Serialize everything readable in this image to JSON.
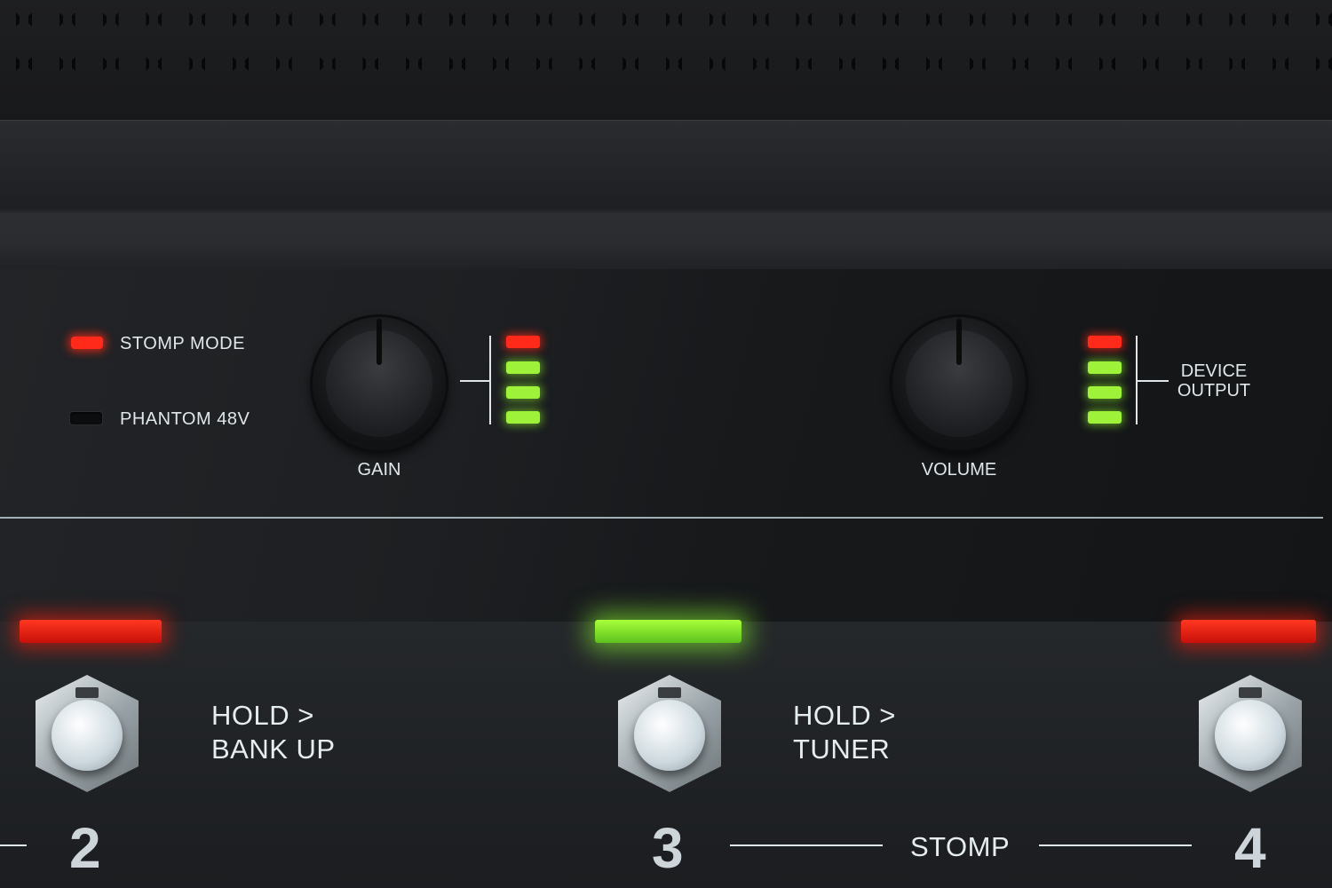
{
  "indicators": {
    "stomp_mode": {
      "label": "STOMP MODE",
      "state": "on",
      "color": "#ff2a1a"
    },
    "phantom": {
      "label": "PHANTOM 48V",
      "state": "off"
    }
  },
  "knobs": {
    "gain": {
      "label": "GAIN"
    },
    "volume": {
      "label": "VOLUME"
    }
  },
  "meters": {
    "input": {
      "segments": [
        "red",
        "green",
        "green",
        "green"
      ]
    },
    "output": {
      "label_line1": "DEVICE",
      "label_line2": "OUTPUT",
      "segments": [
        "red",
        "green",
        "green",
        "green"
      ]
    }
  },
  "footswitches": {
    "sw2": {
      "number": "2",
      "hold_line1": "HOLD >",
      "hold_line2": "BANK UP",
      "light": "red"
    },
    "sw3": {
      "number": "3",
      "hold_line1": "HOLD >",
      "hold_line2": "TUNER",
      "light": "green"
    },
    "sw4": {
      "number": "4",
      "light": "red"
    }
  },
  "stomp_group_label": "STOMP",
  "colors": {
    "red": "#ff2a1a",
    "green": "#9ff23a",
    "panel": "#1a1c1e"
  }
}
